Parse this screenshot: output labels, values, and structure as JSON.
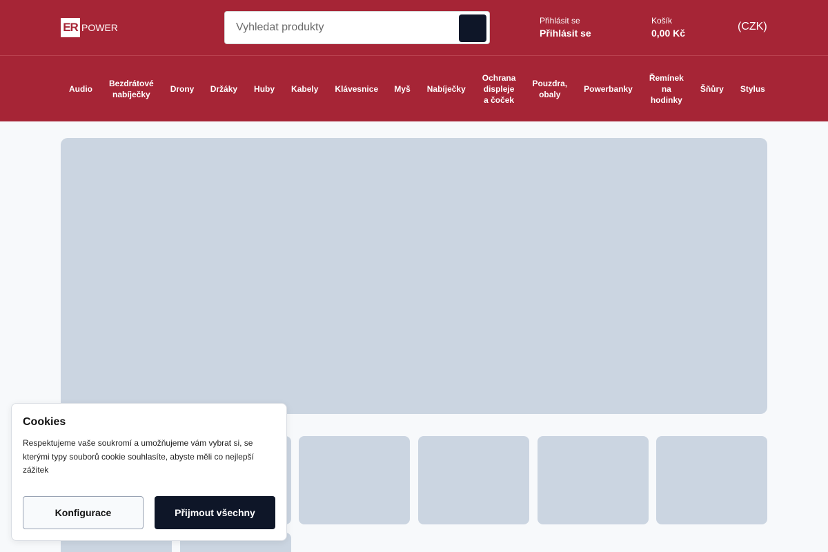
{
  "header": {
    "logo_mark": "ER",
    "logo_text": "POWER",
    "search_placeholder": "Vyhledat produkty",
    "login_small": "Přihlásit se",
    "login_big": "Přihlásit se",
    "cart_small": "Košík",
    "cart_total": "0,00 Kč",
    "currency": "(CZK)"
  },
  "nav": {
    "items": [
      "Audio",
      "Bezdrátové nabíječky",
      "Drony",
      "Držáky",
      "Huby",
      "Kabely",
      "Klávesnice",
      "Myš",
      "Nabíječky",
      "Ochrana displeje a čoček",
      "Pouzdra, obaly",
      "Powerbanky",
      "Řemínek na hodinky",
      "Šňůry",
      "Stylus"
    ]
  },
  "cookie": {
    "title": "Cookies",
    "text": "Respektujeme vaše soukromí a umožňujeme vám vybrat si, se kterými typy souborů cookie souhlasíte, abyste měli co nejlepší zážitek",
    "config_label": "Konfigurace",
    "accept_label": "Přijmout všechny"
  },
  "colors": {
    "brand": "#a62536",
    "dark": "#0e1628",
    "placeholder": "#cbd5e1"
  }
}
